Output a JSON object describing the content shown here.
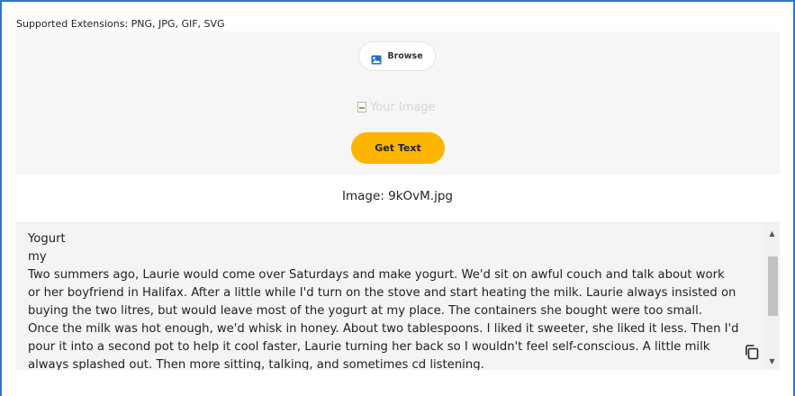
{
  "upload": {
    "supported_extensions_label": "Supported Extensions: PNG, JPG, GIF, SVG",
    "browse_label": "Browse",
    "image_alt": "Your Image",
    "get_text_label": "Get Text"
  },
  "result": {
    "image_name": "Image: 9kOvM.jpg",
    "extracted_text": "Yogurt\nmy\nTwo summers ago, Laurie would come over Saturdays and make yogurt. We'd sit on awful couch and talk about work\nor her boyfriend in Halifax. After a little while I'd turn on the stove and start heating the milk. Laurie always insisted on\nbuying the two litres, but would leave most of the yogurt at my place. The containers she bought were too small.\nOnce the milk was hot enough, we'd whisk in honey. About two tablespoons. I liked it sweeter, she liked it less. Then I'd\npour it into a second pot to help it cool faster, Laurie turning her back so I wouldn't feel self-conscious. A little milk\nalways splashed out. Then more sitting, talking, and sometimes cd listening."
  },
  "icons": {
    "browse": "image-icon",
    "copy": "copy-icon",
    "scroll_up": "arrow-up-icon",
    "scroll_down": "arrow-down-icon"
  },
  "colors": {
    "accent": "#fdb500",
    "frame": "#2a78d6",
    "image_icon": "#1f6fd1"
  }
}
